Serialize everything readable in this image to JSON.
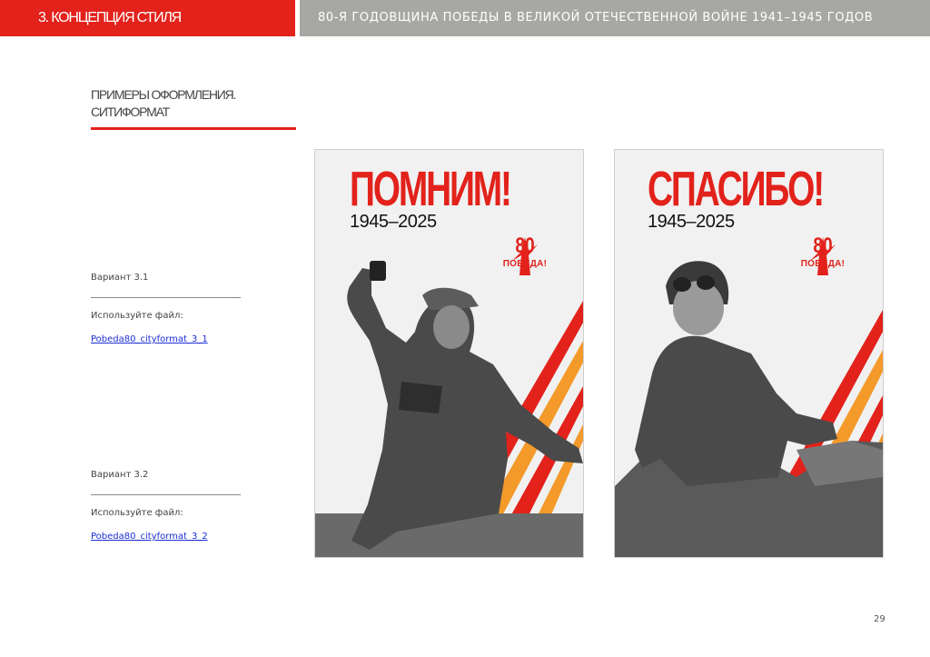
{
  "header": {
    "section": "3. КОНЦЕПЦИЯ СТИЛЯ",
    "title": "80-Я ГОДОВЩИНА ПОБЕДЫ В ВЕЛИКОЙ ОТЕЧЕСТВЕННОЙ ВОЙНЕ 1941–1945 ГОДОВ"
  },
  "section_title": {
    "line1": "ПРИМЕРЫ ОФОРМЛЕНИЯ.",
    "line2": "СИТИФОРМАТ"
  },
  "variants": [
    {
      "label": "Вариант 3.1",
      "use_text": "Используйте файл:",
      "file": "Pobeda80_cityformat_3_1"
    },
    {
      "label": "Вариант 3.2",
      "use_text": "Используйте файл:",
      "file": "Pobeda80_cityformat_3_2"
    }
  ],
  "posters": [
    {
      "headline": "ПОМНИМ!",
      "years": "1945–2025",
      "badge_num": "80",
      "badge_text": "ПОБЕДА!"
    },
    {
      "headline": "СПАСИБО!",
      "years": "1945–2025",
      "badge_num": "80",
      "badge_text": "ПОБЕДА!"
    }
  ],
  "page_number": "29",
  "colors": {
    "accent": "#e2221b",
    "header_gray": "#a7a8a3",
    "stripe_orange": "#f39a2b",
    "link": "#1d2fd4"
  }
}
